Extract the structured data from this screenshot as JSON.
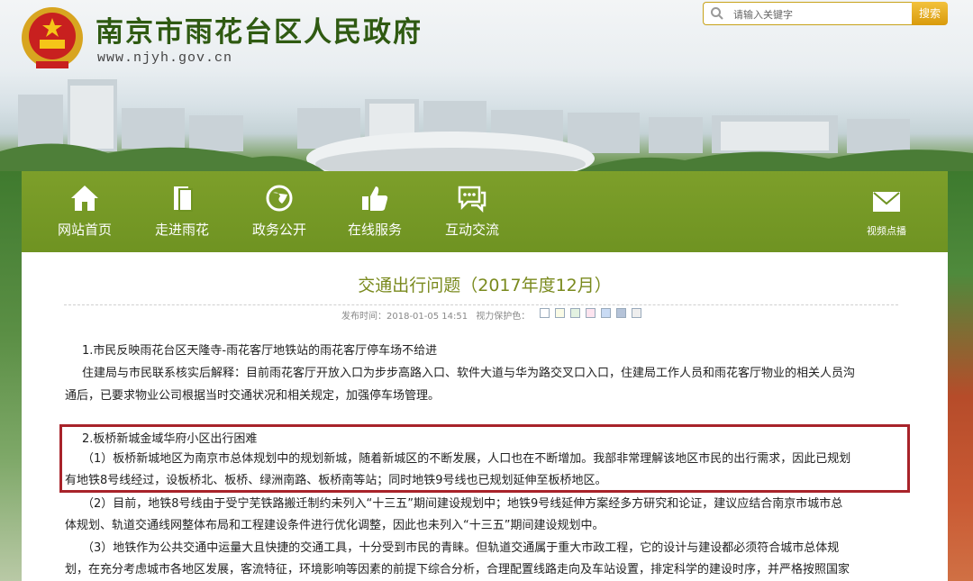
{
  "header": {
    "site_title": "南京市雨花台区人民政府",
    "site_url": "www.njyh.gov.cn",
    "emblem_icon": "national-emblem-icon"
  },
  "search": {
    "placeholder": "请输入关键字",
    "button_label": "搜索"
  },
  "nav": {
    "items": [
      {
        "label": "网站首页",
        "icon": "home-icon"
      },
      {
        "label": "走进雨花",
        "icon": "book-icon"
      },
      {
        "label": "政务公开",
        "icon": "globe-icon"
      },
      {
        "label": "在线服务",
        "icon": "thumbs-up-icon"
      },
      {
        "label": "互动交流",
        "icon": "chat-icon"
      }
    ],
    "video": {
      "label": "视频点播",
      "icon": "envelope-icon"
    }
  },
  "article": {
    "title": "交通出行问题（2017年度12月）",
    "publish_label": "发布时间：2018-01-05 14:51",
    "eye_label": "视力保护色：",
    "swatch_colors": [
      "#ffffff",
      "#fafbe6",
      "#e3f2e1",
      "#fde4ef",
      "#c9dbf4",
      "#b5c3d8",
      "#eeeeee"
    ],
    "lines": [
      "1.市民反映雨花台区天隆寺-雨花客厅地铁站的雨花客厅停车场不给进",
      "住建局与市民联系核实后解释：目前雨花客厅开放入口为步步高路入口、软件大道与华为路交叉口入口，住建局工作人员和雨花客厅物业的相关人员沟",
      "通后，已要求物业公司根据当时交通状况和相关规定，加强停车场管理。",
      "2.板桥新城金域华府小区出行困难",
      "（1）板桥新城地区为南京市总体规划中的规划新城，随着新城区的不断发展，人口也在不断增加。我部非常理解该地区市民的出行需求，因此已规划",
      "有地铁8号线经过，设板桥北、板桥、绿洲南路、板桥南等站；同时地铁9号线也已规划延伸至板桥地区。",
      "（2）目前，地铁8号线由于受宁芜铁路搬迁制约未列入“十三五”期间建设规划中；地铁9号线延伸方案经多方研究和论证，建议应结合南京市城市总",
      "体规划、轨道交通线网整体布局和工程建设条件进行优化调整，因此也未列入“十三五”期间建设规划中。",
      "（3）地铁作为公共交通中运量大且快捷的交通工具，十分受到市民的青睐。但轨道交通属于重大市政工程，它的设计与建设都必须符合城市总体规",
      "划，在充分考虑城市各地区发展，客流特征，环境影响等因素的前提下综合分析，合理配置线路走向及车站设置，排定科学的建设时序，并严格按照国家"
    ]
  }
}
